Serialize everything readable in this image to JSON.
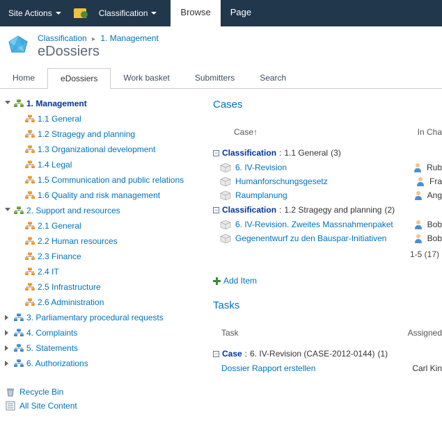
{
  "ribbon": {
    "site_actions": "Site Actions",
    "classification": "Classification",
    "tab_browse": "Browse",
    "tab_page": "Page"
  },
  "breadcrumb": {
    "a": "Classification",
    "b": "1. Management"
  },
  "page_title": "eDossiers",
  "nav": {
    "home": "Home",
    "edossiers": "eDossiers",
    "workbasket": "Work basket",
    "submitters": "Submitters",
    "search": "Search"
  },
  "tree": {
    "n1": {
      "label": "1. Management"
    },
    "n1_1": {
      "label": "1.1 General"
    },
    "n1_2": {
      "label": "1.2 Stragegy and planning"
    },
    "n1_3": {
      "label": "1.3 Organizational development"
    },
    "n1_4": {
      "label": "1.4 Legal"
    },
    "n1_5": {
      "label": "1.5 Communication and public relations"
    },
    "n1_6": {
      "label": "1.6 Quality and risk management"
    },
    "n2": {
      "label": "2. Support and resources"
    },
    "n2_1": {
      "label": "2.1 General"
    },
    "n2_2": {
      "label": "2.2 Human resources"
    },
    "n2_3": {
      "label": "2.3 Finance"
    },
    "n2_4": {
      "label": "2.4 IT"
    },
    "n2_5": {
      "label": "2.5 Infrastructure"
    },
    "n2_6": {
      "label": "2.6 Administration"
    },
    "n3": {
      "label": "3. Parliamentary procedural requests"
    },
    "n4": {
      "label": "4. Complaints"
    },
    "n5": {
      "label": "5. Statements"
    },
    "n6": {
      "label": "6. Authorizations"
    }
  },
  "util": {
    "recycle": "Recycle Bin",
    "allcontent": "All Site Content"
  },
  "cases": {
    "title": "Cases",
    "col_case": "Case↑",
    "col_charge": "In Cha",
    "group_label": "Classification",
    "g1_value": "1.1 General",
    "g1_count": "(3)",
    "g2_value": "1.2 Stragegy and planning",
    "g2_count": "(2)",
    "r1": {
      "title": "6. IV-Revision",
      "user": "Rub"
    },
    "r2": {
      "title": "Humanforschungsgesetz",
      "user": "Fra"
    },
    "r3": {
      "title": "Raumplanung",
      "user": "Ang"
    },
    "r4": {
      "title": "6. IV-Revision. Zweites Massnahmenpaket",
      "user": "Bob"
    },
    "r5": {
      "title": "Gegenentwurf zu den Bauspar-Initiativen",
      "user": "Bob"
    },
    "pager": "1-5 (17)",
    "add": "Add Item"
  },
  "tasks": {
    "title": "Tasks",
    "col_task": "Task",
    "col_assigned": "Assigned",
    "group_label": "Case",
    "g1_value": "6. IV-Revision (CASE-2012-0144)",
    "g1_count": "(1)",
    "r1": {
      "title": "Dossier Rapport erstellen",
      "user": "Carl Kin"
    }
  }
}
